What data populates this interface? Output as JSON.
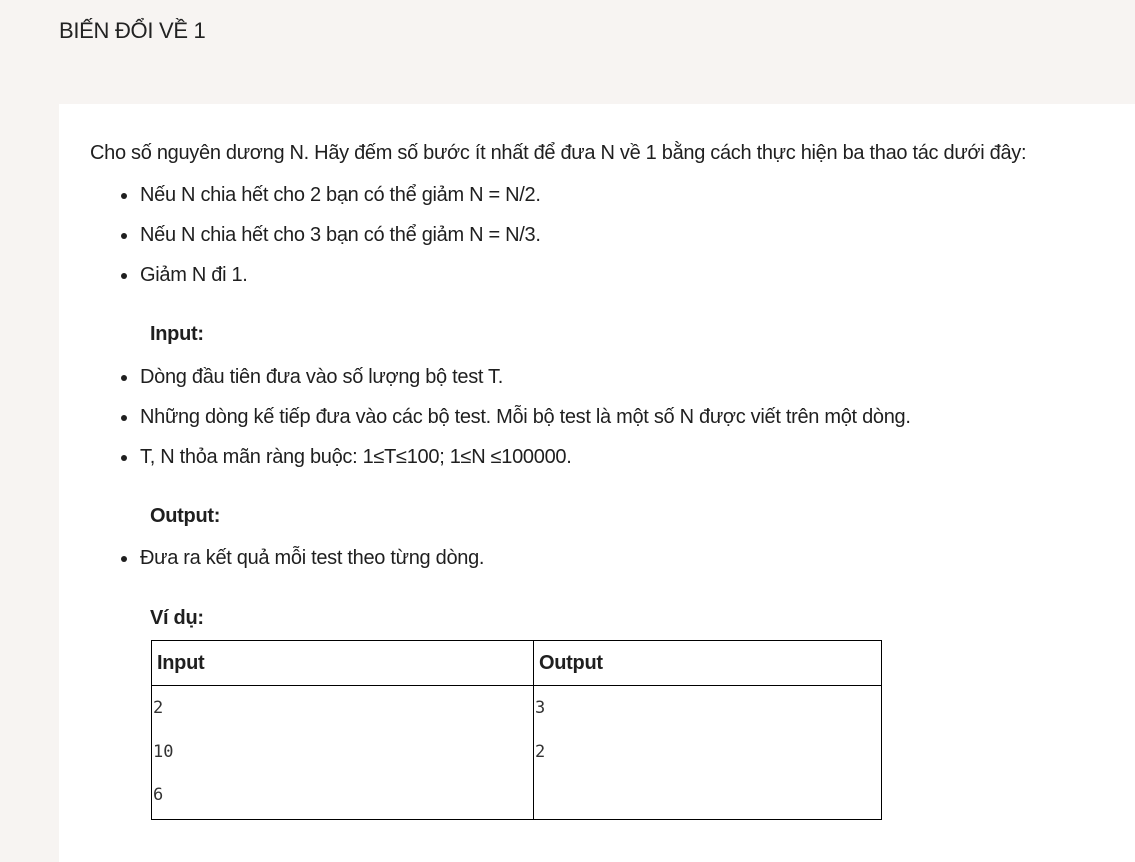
{
  "title": "BIẾN ĐỔI VỀ 1",
  "intro": "Cho số nguyên dương N. Hãy đếm số bước ít nhất để đưa N về 1 bằng cách thực hiện ba thao tác dưới đây:",
  "operations": [
    "Nếu N chia hết cho 2 bạn có thể giảm N = N/2.",
    "Nếu N chia hết cho 3 bạn có thể giảm N = N/3.",
    "Giảm N đi 1."
  ],
  "input_heading": "Input:",
  "input_items": [
    "Dòng đầu tiên đưa vào số lượng bộ test T.",
    "Những dòng kế tiếp đưa vào các bộ test. Mỗi bộ test là một số N được viết trên một dòng.",
    "T, N thỏa mãn ràng buộc: 1≤T≤100;  1≤N ≤100000."
  ],
  "output_heading": "Output:",
  "output_items": [
    "Đưa ra kết quả mỗi test theo từng dòng."
  ],
  "example_heading": "Ví dụ:",
  "example_table": {
    "headers": [
      "Input",
      "Output"
    ],
    "input_lines": [
      "2",
      "10",
      "6"
    ],
    "output_lines": [
      "3",
      "2"
    ]
  }
}
